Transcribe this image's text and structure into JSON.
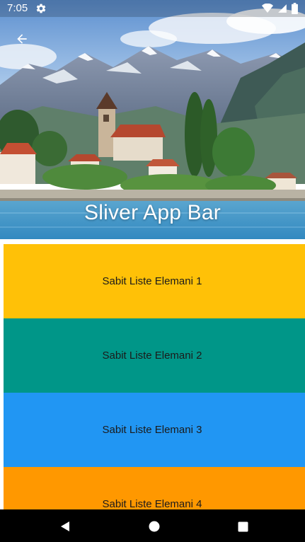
{
  "status_bar": {
    "time": "7:05",
    "icons": [
      "gear-icon",
      "wifi-icon",
      "cellular-signal-icon",
      "battery-icon"
    ]
  },
  "app_bar": {
    "title": "Sliver App Bar",
    "back_icon": "arrow-back-icon",
    "background_image": "lakeside-village-with-mountains",
    "title_color": "#ffffff"
  },
  "list": {
    "items": [
      {
        "label": "Sabit Liste Elemani 1",
        "color": "#FFC107"
      },
      {
        "label": "Sabit Liste Elemani 2",
        "color": "#009688"
      },
      {
        "label": "Sabit Liste Elemani 3",
        "color": "#2196F3"
      },
      {
        "label": "Sabit Liste Elemani 4",
        "color": "#FF9800"
      }
    ]
  },
  "nav_bar": {
    "buttons": [
      "back-triangle-icon",
      "home-circle-icon",
      "recents-square-icon"
    ]
  }
}
